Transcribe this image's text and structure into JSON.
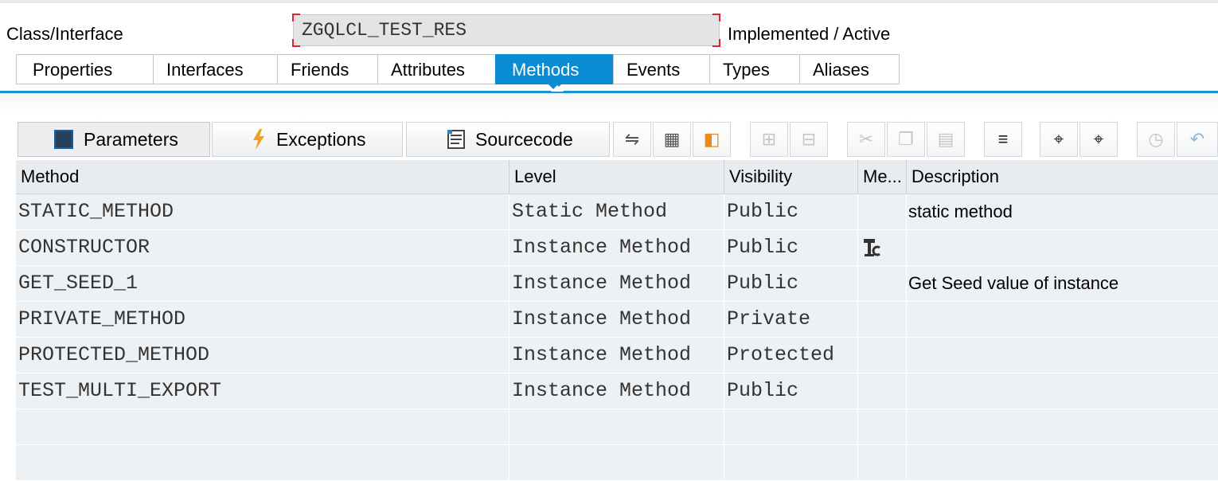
{
  "header": {
    "class_label": "Class/Interface",
    "class_name": "ZGQLCL_TEST_RES",
    "status": "Implemented / Active"
  },
  "tabs": [
    {
      "label": "Properties",
      "active": false
    },
    {
      "label": "Interfaces",
      "active": false
    },
    {
      "label": "Friends",
      "active": false
    },
    {
      "label": "Attributes",
      "active": false
    },
    {
      "label": "Methods",
      "active": true
    },
    {
      "label": "Events",
      "active": false
    },
    {
      "label": "Types",
      "active": false
    },
    {
      "label": "Aliases",
      "active": false
    }
  ],
  "toolbar": {
    "parameters_label": "Parameters",
    "exceptions_label": "Exceptions",
    "sourcecode_label": "Sourcecode",
    "icon_buttons": [
      "navigate-icon",
      "details-icon",
      "tree-icon",
      "insert-row-icon",
      "delete-row-icon",
      "cut-icon",
      "copy-icon",
      "paste-icon",
      "sort-icon",
      "find-icon",
      "find-next-icon",
      "undo-check-icon",
      "undo-icon"
    ]
  },
  "table": {
    "columns": [
      "Method",
      "Level",
      "Visibility",
      "Me...",
      "Description"
    ],
    "rows": [
      {
        "method": "STATIC_METHOD",
        "level": "Static Method",
        "visibility": "Public",
        "me": "",
        "description": "static method"
      },
      {
        "method": "CONSTRUCTOR",
        "level": "Instance Method",
        "visibility": "Public",
        "me": "constructor-icon",
        "description": ""
      },
      {
        "method": "GET_SEED_1",
        "level": "Instance Method",
        "visibility": "Public",
        "me": "",
        "description": "Get Seed value of instance"
      },
      {
        "method": "PRIVATE_METHOD",
        "level": "Instance Method",
        "visibility": "Private",
        "me": "",
        "description": ""
      },
      {
        "method": "PROTECTED_METHOD",
        "level": "Instance Method",
        "visibility": "Protected",
        "me": "",
        "description": ""
      },
      {
        "method": "TEST_MULTI_EXPORT",
        "level": "Instance Method",
        "visibility": "Public",
        "me": "",
        "description": ""
      },
      {
        "method": "",
        "level": "",
        "visibility": "",
        "me": "",
        "description": ""
      },
      {
        "method": "",
        "level": "",
        "visibility": "",
        "me": "",
        "description": ""
      }
    ]
  },
  "colors": {
    "active_tab": "#0a8cd2",
    "focus_corner": "#d9262c",
    "row_bg": "#eef1f4"
  }
}
